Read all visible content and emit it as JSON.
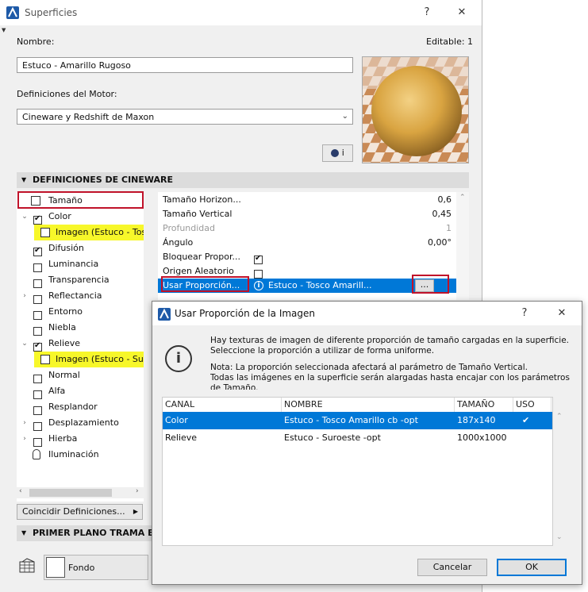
{
  "main": {
    "title": "Superficies",
    "help": "?",
    "close": "✕",
    "name_label": "Nombre:",
    "editable_label": "Editable: 1",
    "name_value": "Estuco - Amarillo Rugoso",
    "engine_label": "Definiciones del Motor:",
    "engine_value": "Cineware y Redshift de Maxon",
    "info_button": "i",
    "section_cineware": "DEFINICIONES DE CINEWARE",
    "channels": [
      {
        "label": "Tamaño",
        "type": "icon"
      },
      {
        "label": "Color",
        "checked": true,
        "expanded": true
      },
      {
        "label": "Imagen (Estuco - Tosco",
        "type": "image"
      },
      {
        "label": "Difusión",
        "checked": true
      },
      {
        "label": "Luminancia",
        "checked": false
      },
      {
        "label": "Transparencia",
        "checked": false
      },
      {
        "label": "Reflectancia",
        "checked": false,
        "collapsed": true
      },
      {
        "label": "Entorno",
        "checked": false
      },
      {
        "label": "Niebla",
        "checked": false
      },
      {
        "label": "Relieve",
        "checked": true,
        "expanded": true
      },
      {
        "label": "Imagen (Estuco - Suro",
        "type": "image"
      },
      {
        "label": "Normal",
        "checked": false
      },
      {
        "label": "Alfa",
        "checked": false
      },
      {
        "label": "Resplandor",
        "checked": false
      },
      {
        "label": "Desplazamiento",
        "checked": false,
        "collapsed": true
      },
      {
        "label": "Hierba",
        "checked": false,
        "collapsed": true
      },
      {
        "label": "Iluminación",
        "type": "icon"
      }
    ],
    "properties": [
      {
        "name": "Tamaño Horizon...",
        "value": "0,6"
      },
      {
        "name": "Tamaño Vertical",
        "value": "0,45"
      },
      {
        "name": "Profundidad",
        "value": "1",
        "disabled": true
      },
      {
        "name": "Ángulo",
        "value": "0,00°"
      },
      {
        "name": "Bloquear Propor...",
        "checkbox": true,
        "checked": true
      },
      {
        "name": "Origen Aleatorio",
        "checkbox": true,
        "checked": false
      },
      {
        "name": "Usar Proporción...",
        "value": "Estuco - Tosco Amarill...",
        "selected": true
      }
    ],
    "ellipsis_button": "...",
    "match_button": "Coincidir Definiciones...",
    "section_primer": "PRIMER PLANO TRAMA ENV",
    "fondo_label": "Fondo"
  },
  "dialog": {
    "title": "Usar Proporción de la Imagen",
    "help": "?",
    "close": "✕",
    "message_line1": "Hay texturas de imagen de diferente proporción de tamaño cargadas en la superficie.",
    "message_line2": "Seleccione la proporción a utilizar de forma uniforme.",
    "note_line1": "Nota: La proporción seleccionada afectará al parámetro de Tamaño Vertical.",
    "note_line2": "Todas las imágenes en la superficie serán alargadas hasta encajar con los parámetros",
    "note_line3": "de Tamaño.",
    "columns": [
      "CANAL",
      "NOMBRE",
      "TAMAÑO",
      "USO"
    ],
    "rows": [
      {
        "canal": "Color",
        "nombre": "Estuco - Tosco Amarillo cb -opt",
        "tamano": "187x140",
        "uso": "✔",
        "selected": true
      },
      {
        "canal": "Relieve",
        "nombre": "Estuco - Suroeste -opt",
        "tamano": "1000x1000",
        "uso": "",
        "selected": false
      }
    ],
    "cancel": "Cancelar",
    "ok": "OK"
  },
  "colors": {
    "selection_blue": "#0078d7",
    "highlight_yellow": "#f7f72a",
    "annotation_red": "#c0122a",
    "sphere_gold": "#d9a441"
  }
}
